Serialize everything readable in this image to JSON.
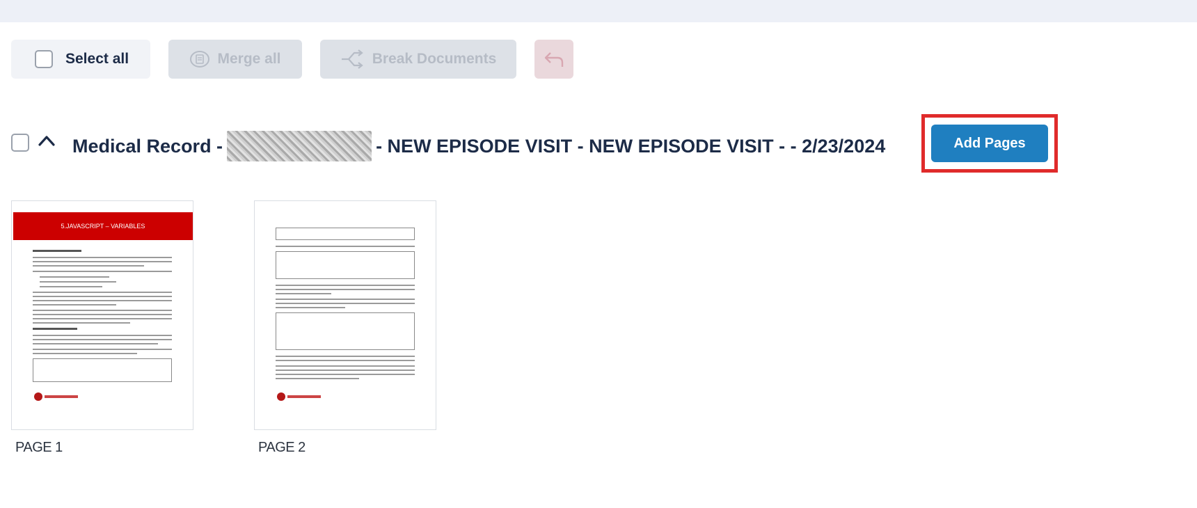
{
  "toolbar": {
    "select_all_label": "Select all",
    "merge_all_label": "Merge all",
    "break_documents_label": "Break Documents"
  },
  "document": {
    "title_prefix": "Medical Record -",
    "title_suffix": "- NEW EPISODE VISIT - NEW EPISODE VISIT - - 2/23/2024",
    "add_pages_label": "Add Pages"
  },
  "pages": [
    {
      "label": "PAGE 1",
      "banner_text": "5.JAVASCRIPT – VARIABLES"
    },
    {
      "label": "PAGE 2"
    }
  ],
  "colors": {
    "accent_button": "#1f7fc0",
    "highlight_border": "#e02b2b",
    "banner_red": "#cc0000",
    "title_text": "#1c2b47"
  }
}
